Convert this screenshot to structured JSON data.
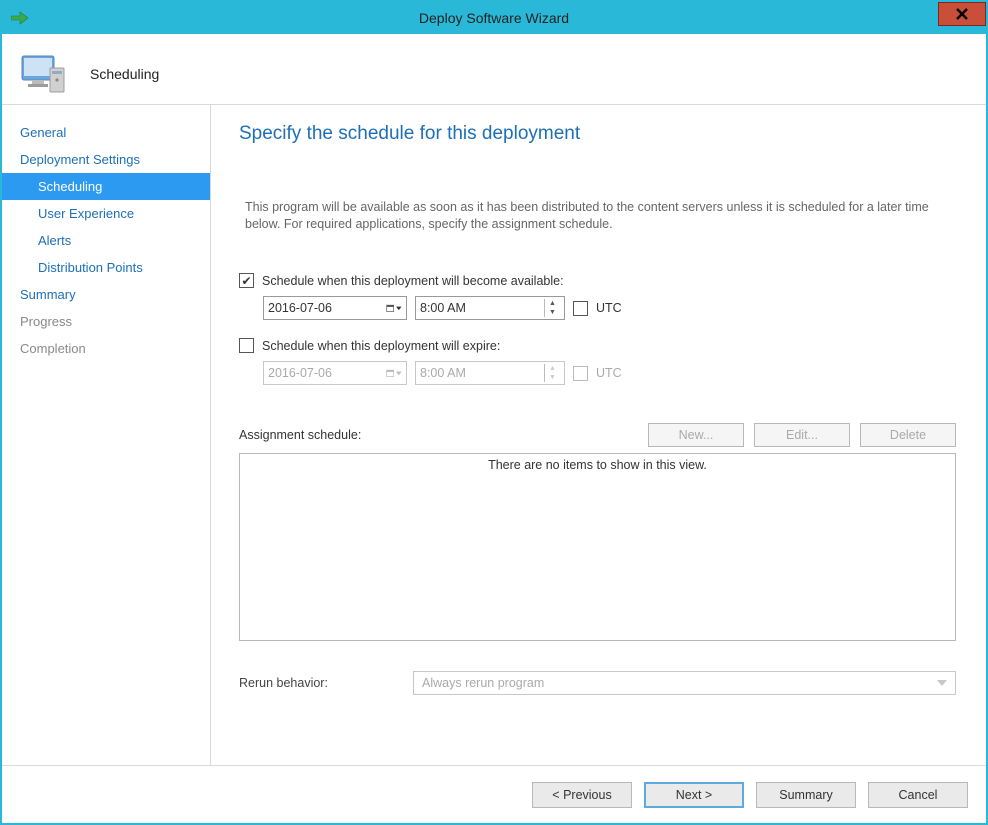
{
  "titlebar": {
    "title": "Deploy Software Wizard"
  },
  "banner": {
    "page_name": "Scheduling"
  },
  "sidebar": {
    "items": [
      {
        "label": "General",
        "sub": false,
        "selected": false,
        "muted": false
      },
      {
        "label": "Deployment Settings",
        "sub": false,
        "selected": false,
        "muted": false
      },
      {
        "label": "Scheduling",
        "sub": true,
        "selected": true,
        "muted": false
      },
      {
        "label": "User Experience",
        "sub": true,
        "selected": false,
        "muted": false
      },
      {
        "label": "Alerts",
        "sub": true,
        "selected": false,
        "muted": false
      },
      {
        "label": "Distribution Points",
        "sub": true,
        "selected": false,
        "muted": false
      },
      {
        "label": "Summary",
        "sub": false,
        "selected": false,
        "muted": false
      },
      {
        "label": "Progress",
        "sub": false,
        "selected": false,
        "muted": true
      },
      {
        "label": "Completion",
        "sub": false,
        "selected": false,
        "muted": true
      }
    ]
  },
  "main": {
    "title": "Specify the schedule for this deployment",
    "intro": "This program will be available as soon as it has been distributed to the content servers unless it is scheduled for a later time below. For required applications, specify the assignment schedule.",
    "available": {
      "label": "Schedule when this deployment will become available:",
      "checked": true,
      "date": "2016-07-06",
      "time": "8:00 AM",
      "utc_label": "UTC",
      "utc_checked": false
    },
    "expire": {
      "label": "Schedule when this deployment will expire:",
      "checked": false,
      "date": "2016-07-06",
      "time": "8:00 AM",
      "utc_label": "UTC",
      "utc_checked": false
    },
    "assignment": {
      "label": "Assignment schedule:",
      "btn_new": "New...",
      "btn_edit": "Edit...",
      "btn_delete": "Delete",
      "empty": "There are no items to show in this view."
    },
    "rerun": {
      "label": "Rerun behavior:",
      "value": "Always rerun program"
    }
  },
  "footer": {
    "previous": "< Previous",
    "next": "Next >",
    "summary": "Summary",
    "cancel": "Cancel"
  }
}
